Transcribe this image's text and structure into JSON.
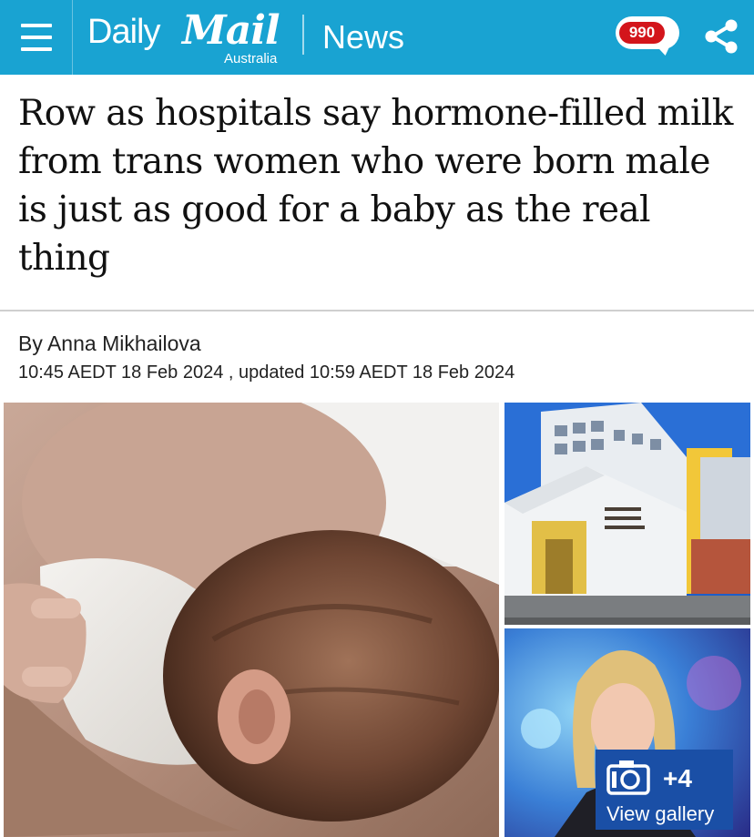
{
  "header": {
    "menu_icon": "hamburger-menu-icon",
    "logo_daily": "Daily",
    "logo_mail": "Mail",
    "logo_region": "Australia",
    "section": "News",
    "comment_count": "990",
    "share_icon": "share-icon",
    "colors": {
      "bar": "#19a3d2",
      "badge": "#d3151b"
    }
  },
  "article": {
    "headline": "Row as hospitals say hormone-filled milk from trans women who were born male is just as good for a baby as the real thing",
    "byline": "By Anna Mikhailova",
    "dateline": "10:45 AEDT 18 Feb 2024 , updated 10:59 AEDT 18 Feb 2024"
  },
  "gallery": {
    "count": "+4",
    "label": "View gallery",
    "icon": "camera-icon",
    "color": "#1a4fa6"
  }
}
